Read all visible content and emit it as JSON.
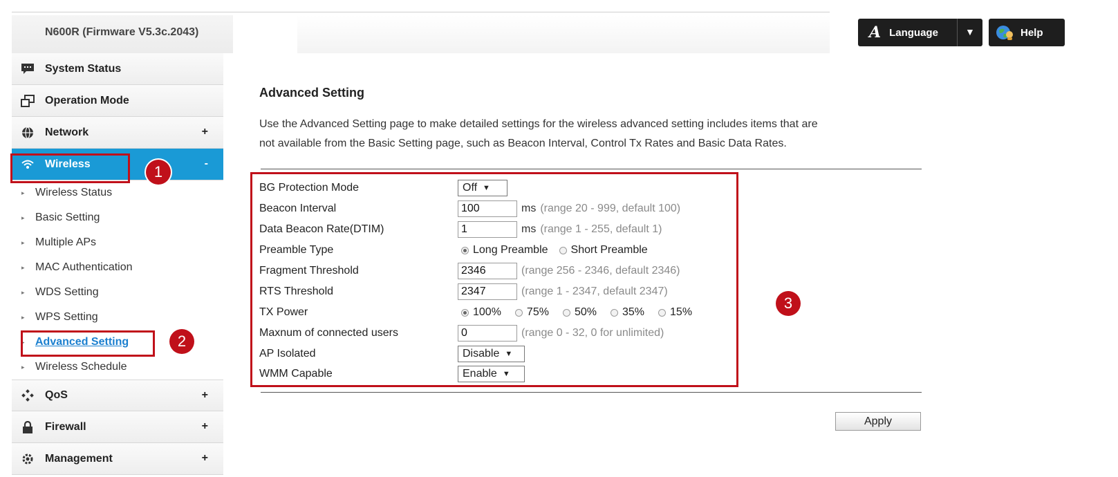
{
  "header": {
    "firmware": "N600R (Firmware V5.3c.2043)",
    "language_label": "Language",
    "help_label": "Help"
  },
  "sidebar": {
    "items": [
      {
        "label": "System Status",
        "icon": "chat-icon",
        "expand": ""
      },
      {
        "label": "Operation Mode",
        "icon": "windows-icon",
        "expand": ""
      },
      {
        "label": "Network",
        "icon": "globe-icon",
        "expand": "+"
      },
      {
        "label": "Wireless",
        "icon": "wifi-icon",
        "expand": "-"
      },
      {
        "label": "QoS",
        "icon": "qos-icon",
        "expand": "+"
      },
      {
        "label": "Firewall",
        "icon": "lock-icon",
        "expand": "+"
      },
      {
        "label": "Management",
        "icon": "gear-icon",
        "expand": "+"
      }
    ],
    "wireless_sub": [
      "Wireless Status",
      "Basic Setting",
      "Multiple APs",
      "MAC Authentication",
      "WDS Setting",
      "WPS Setting",
      "Advanced Setting",
      "Wireless Schedule"
    ]
  },
  "annotations": [
    "1",
    "2",
    "3"
  ],
  "main": {
    "title": "Advanced Setting",
    "desc_line1": "Use the Advanced Setting page to make detailed settings for the wireless advanced setting includes items that are",
    "desc_line2": "not available from the Basic Setting page, such as Beacon Interval, Control Tx Rates and Basic Data Rates.",
    "fields": {
      "bg_protection": {
        "label": "BG Protection Mode",
        "value": "Off"
      },
      "beacon_interval": {
        "label": "Beacon Interval",
        "value": "100",
        "unit": "ms",
        "hint": "(range 20 - 999, default 100)"
      },
      "dtim": {
        "label": "Data Beacon Rate(DTIM)",
        "value": "1",
        "unit": "ms",
        "hint": "(range 1 - 255, default 1)"
      },
      "preamble": {
        "label": "Preamble Type",
        "options": [
          "Long Preamble",
          "Short Preamble"
        ],
        "selected": "Long Preamble"
      },
      "fragment": {
        "label": "Fragment Threshold",
        "value": "2346",
        "hint": "(range 256 - 2346, default 2346)"
      },
      "rts": {
        "label": "RTS Threshold",
        "value": "2347",
        "hint": "(range 1 - 2347, default 2347)"
      },
      "tx_power": {
        "label": "TX Power",
        "options": [
          "100%",
          "75%",
          "50%",
          "35%",
          "15%"
        ],
        "selected": "100%"
      },
      "max_users": {
        "label": "Maxnum of connected users",
        "value": "0",
        "hint": "(range 0 - 32, 0 for unlimited)"
      },
      "ap_isolated": {
        "label": "AP Isolated",
        "value": "Disable"
      },
      "wmm": {
        "label": "WMM Capable",
        "value": "Enable"
      }
    },
    "apply_label": "Apply"
  },
  "colors": {
    "accent": "#1a9ad6",
    "annotation": "#c0101a",
    "link": "#1a7fcf"
  }
}
